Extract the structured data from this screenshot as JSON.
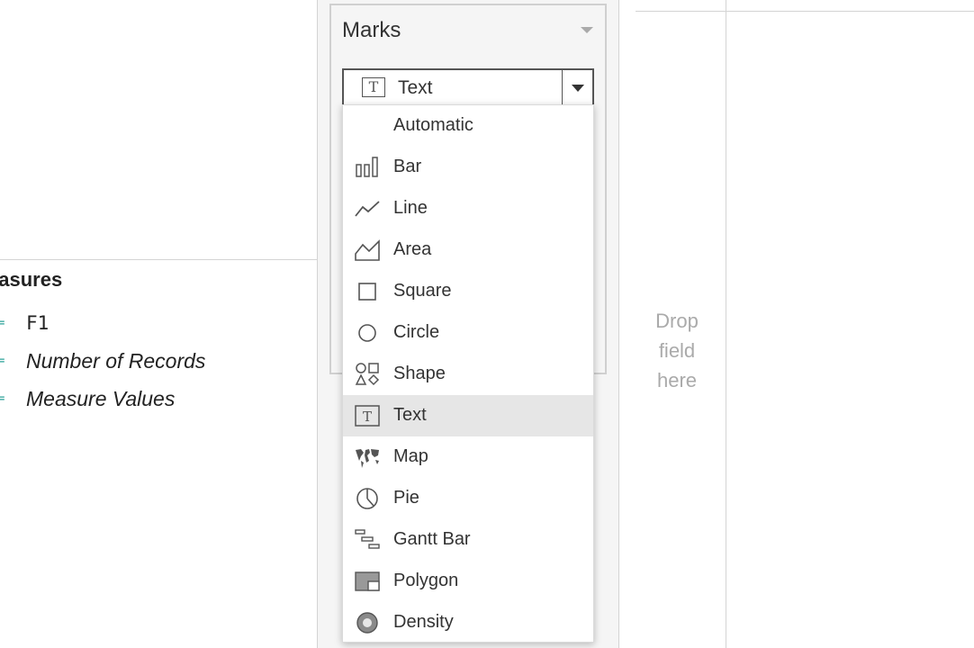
{
  "data_pane": {
    "section_title": "easures",
    "fields": [
      {
        "hash": "=",
        "label": "F1",
        "style": "mono"
      },
      {
        "hash": "=",
        "label": "Number of Records",
        "style": "italic"
      },
      {
        "hash": "=",
        "label": "Measure Values",
        "style": "italic"
      }
    ]
  },
  "marks": {
    "title": "Marks",
    "mark_type": {
      "selected": "Text",
      "icon": "text-icon"
    },
    "options": [
      {
        "label": "Automatic",
        "icon": ""
      },
      {
        "label": "Bar",
        "icon": "bar-icon"
      },
      {
        "label": "Line",
        "icon": "line-icon"
      },
      {
        "label": "Area",
        "icon": "area-icon"
      },
      {
        "label": "Square",
        "icon": "square-icon"
      },
      {
        "label": "Circle",
        "icon": "circle-icon"
      },
      {
        "label": "Shape",
        "icon": "shape-icon"
      },
      {
        "label": "Text",
        "icon": "text-icon"
      },
      {
        "label": "Map",
        "icon": "map-icon"
      },
      {
        "label": "Pie",
        "icon": "pie-icon"
      },
      {
        "label": "Gantt Bar",
        "icon": "gantt-bar-icon"
      },
      {
        "label": "Polygon",
        "icon": "polygon-icon"
      },
      {
        "label": "Density",
        "icon": "density-icon"
      }
    ],
    "selected_index": 7
  },
  "canvas": {
    "drop_hint_lines": [
      "Drop",
      "field",
      "here"
    ]
  },
  "colors": {
    "selected_row_bg": "#e6e6e6",
    "measure_hash": "#2aa198",
    "drop_hint": "#aaaaaa"
  }
}
